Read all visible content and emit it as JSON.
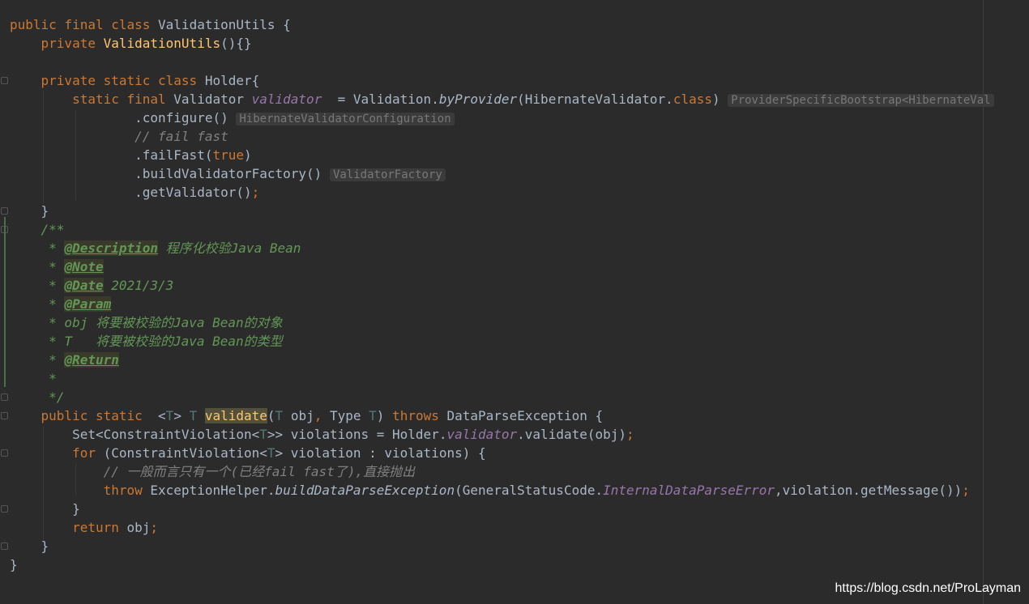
{
  "code": {
    "l1": {
      "kw": "public final class ",
      "name": "ValidationUtils {"
    },
    "l2": {
      "kw": "private ",
      "fn": "ValidationUtils",
      "rest": "(){}"
    },
    "l3": {
      "kw": "private static class ",
      "rest": "Holder{"
    },
    "l4": {
      "kw": "static final ",
      "type": "Validator ",
      "field": "validator",
      "eq": "  = Validation.",
      "method": "byProvider",
      "arg": "(HibernateValidator.",
      "cls": "class",
      "close": ")",
      "hint": "ProviderSpecificBootstrap<HibernateVal"
    },
    "l5": {
      "text": ".configure()",
      "hint": "HibernateValidatorConfiguration"
    },
    "l6": {
      "text": "// fail fast"
    },
    "l7": {
      "pre": ".failFast(",
      "val": "true",
      "post": ")"
    },
    "l8": {
      "text": ".buildValidatorFactory()",
      "hint": "ValidatorFactory"
    },
    "l9": {
      "text": ".getValidator()",
      "semi": ";"
    },
    "l10": {
      "text": "}"
    },
    "l11": {
      "text": "/**"
    },
    "l12": {
      "star": " * ",
      "tag": "@Description",
      "text": " 程序化校验Java Bean"
    },
    "l13": {
      "star": " * ",
      "tag": "@Note"
    },
    "l14": {
      "star": " * ",
      "tag": "@Date",
      "text": " 2021/3/3"
    },
    "l15": {
      "star": " * ",
      "tag": "@Param"
    },
    "l16": {
      "text": " * obj 将要被校验的Java Bean的对象"
    },
    "l17": {
      "text": " * T   将要被校验的Java Bean的类型"
    },
    "l18": {
      "star": " * ",
      "tag": "@Return"
    },
    "l19": {
      "text": " *"
    },
    "l20": {
      "text": " */"
    },
    "l21": {
      "kw": "public static  ",
      "lt": "<",
      "tp": "T",
      "gt": "> ",
      "tp2": "T ",
      "fn": "validate",
      "p1": "(",
      "tp3": "T",
      "a1": " obj",
      "comma": ", ",
      "a2": "Type ",
      "tp4": "T",
      "p2": ") ",
      "throws": "throws ",
      "exc": "DataParseException {"
    },
    "l22": {
      "pre": "Set<ConstraintViolation<",
      "tp": "T",
      "mid": ">> violations = Holder.",
      "field": "validator",
      "post": ".validate(obj)",
      "semi": ";"
    },
    "l23": {
      "kw": "for ",
      "pre": "(ConstraintViolation<",
      "tp": "T",
      "post": "> violation : violations) {"
    },
    "l24": {
      "text": "// 一般而言只有一个(已经fail fast了),直接抛出"
    },
    "l25": {
      "kw": "throw ",
      "pre": "ExceptionHelper.",
      "method": "buildDataParseException",
      "mid": "(GeneralStatusCode.",
      "field": "InternalDataParseError",
      "post": ",violation.getMessage())",
      "semi": ";"
    },
    "l26": {
      "text": "}"
    },
    "l27": {
      "kw": "return ",
      "text": "obj",
      "semi": ";"
    },
    "l28": {
      "text": "}"
    },
    "l29": {
      "text": "}"
    }
  },
  "watermark": "https://blog.csdn.net/ProLayman",
  "colors": {
    "background": "#2b2b2b",
    "keyword": "#cc7832",
    "comment": "#808080",
    "doc": "#629755",
    "field": "#9876aa",
    "method_decl": "#ffc66d"
  }
}
